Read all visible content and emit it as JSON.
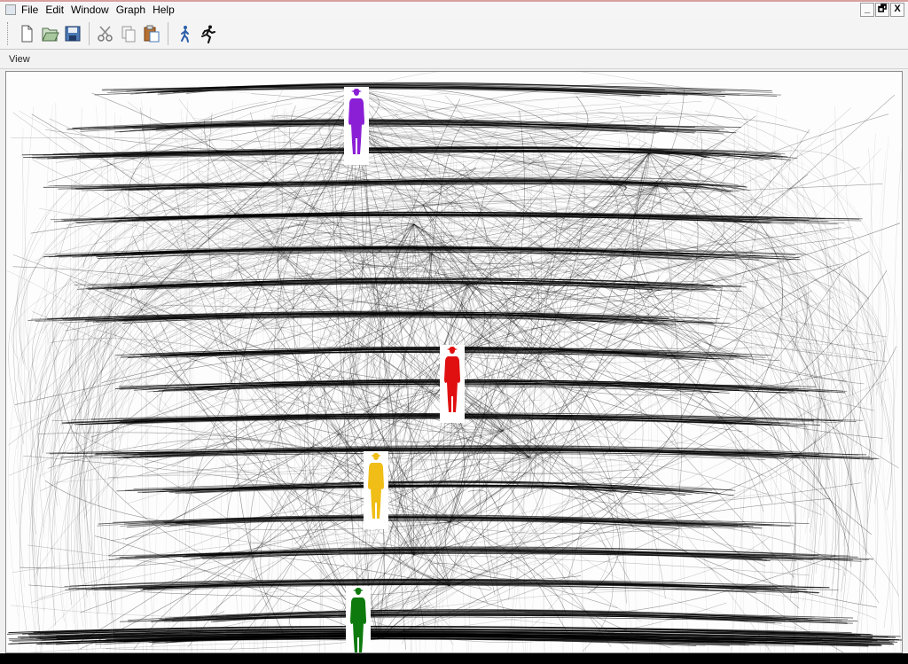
{
  "menu": {
    "items": [
      "File",
      "Edit",
      "Window",
      "Graph",
      "Help"
    ]
  },
  "window_controls": {
    "minimize": "_",
    "restore": "🗗",
    "close": "X"
  },
  "toolbar": {
    "buttons": [
      "new-icon",
      "open-icon",
      "save-icon",
      "cut-icon",
      "copy-icon",
      "paste-icon",
      "walk-icon",
      "run-icon"
    ]
  },
  "view_label": "View",
  "figures": [
    {
      "name": "purple-person-node",
      "color": "#8a1fd6"
    },
    {
      "name": "red-person-node",
      "color": "#e01010"
    },
    {
      "name": "yellow-person-node",
      "color": "#f0be16"
    },
    {
      "name": "green-person-node",
      "color": "#0e7a0e"
    }
  ],
  "colors": {
    "edge": "#000000",
    "canvas": "#fdfdfd"
  }
}
